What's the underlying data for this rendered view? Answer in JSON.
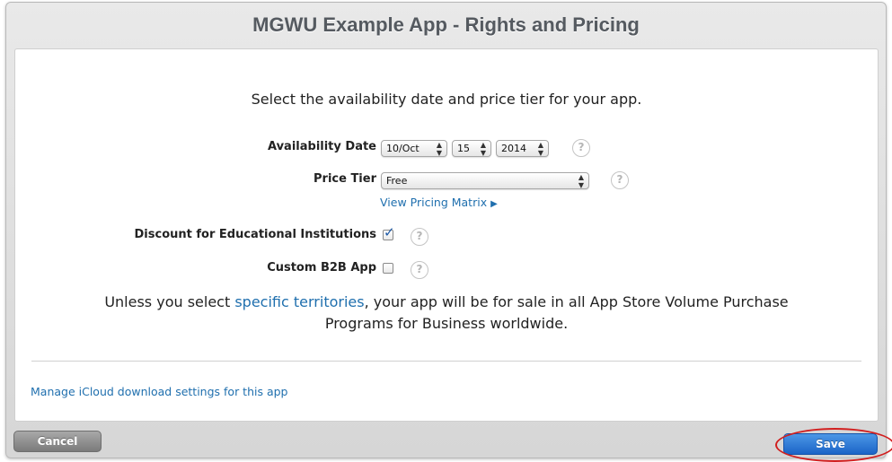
{
  "dialog": {
    "title": "MGWU Example App - Rights and Pricing"
  },
  "main": {
    "intro": "Select the availability date and price tier for your app.",
    "availability": {
      "label": "Availability Date",
      "month": "10/Oct",
      "day": "15",
      "year": "2014"
    },
    "price_tier": {
      "label": "Price Tier",
      "value": "Free",
      "matrix_link": "View Pricing Matrix"
    },
    "discount": {
      "label": "Discount for Educational Institutions",
      "checked": true
    },
    "custom_b2b": {
      "label": "Custom B2B App",
      "checked": false
    },
    "notice": {
      "before": "Unless you select ",
      "link": "specific territories",
      "after": ", your app will be for sale in all App Store Volume Purchase",
      "line2": "Programs for Business worldwide."
    },
    "icloud_link": "Manage iCloud download settings for this app",
    "help_glyph": "?"
  },
  "footer": {
    "cancel_label": "Cancel",
    "save_label": "Save"
  },
  "colors": {
    "link": "#1f6fae",
    "save_button": "#1b64c7",
    "highlight": "#d11f1f"
  }
}
